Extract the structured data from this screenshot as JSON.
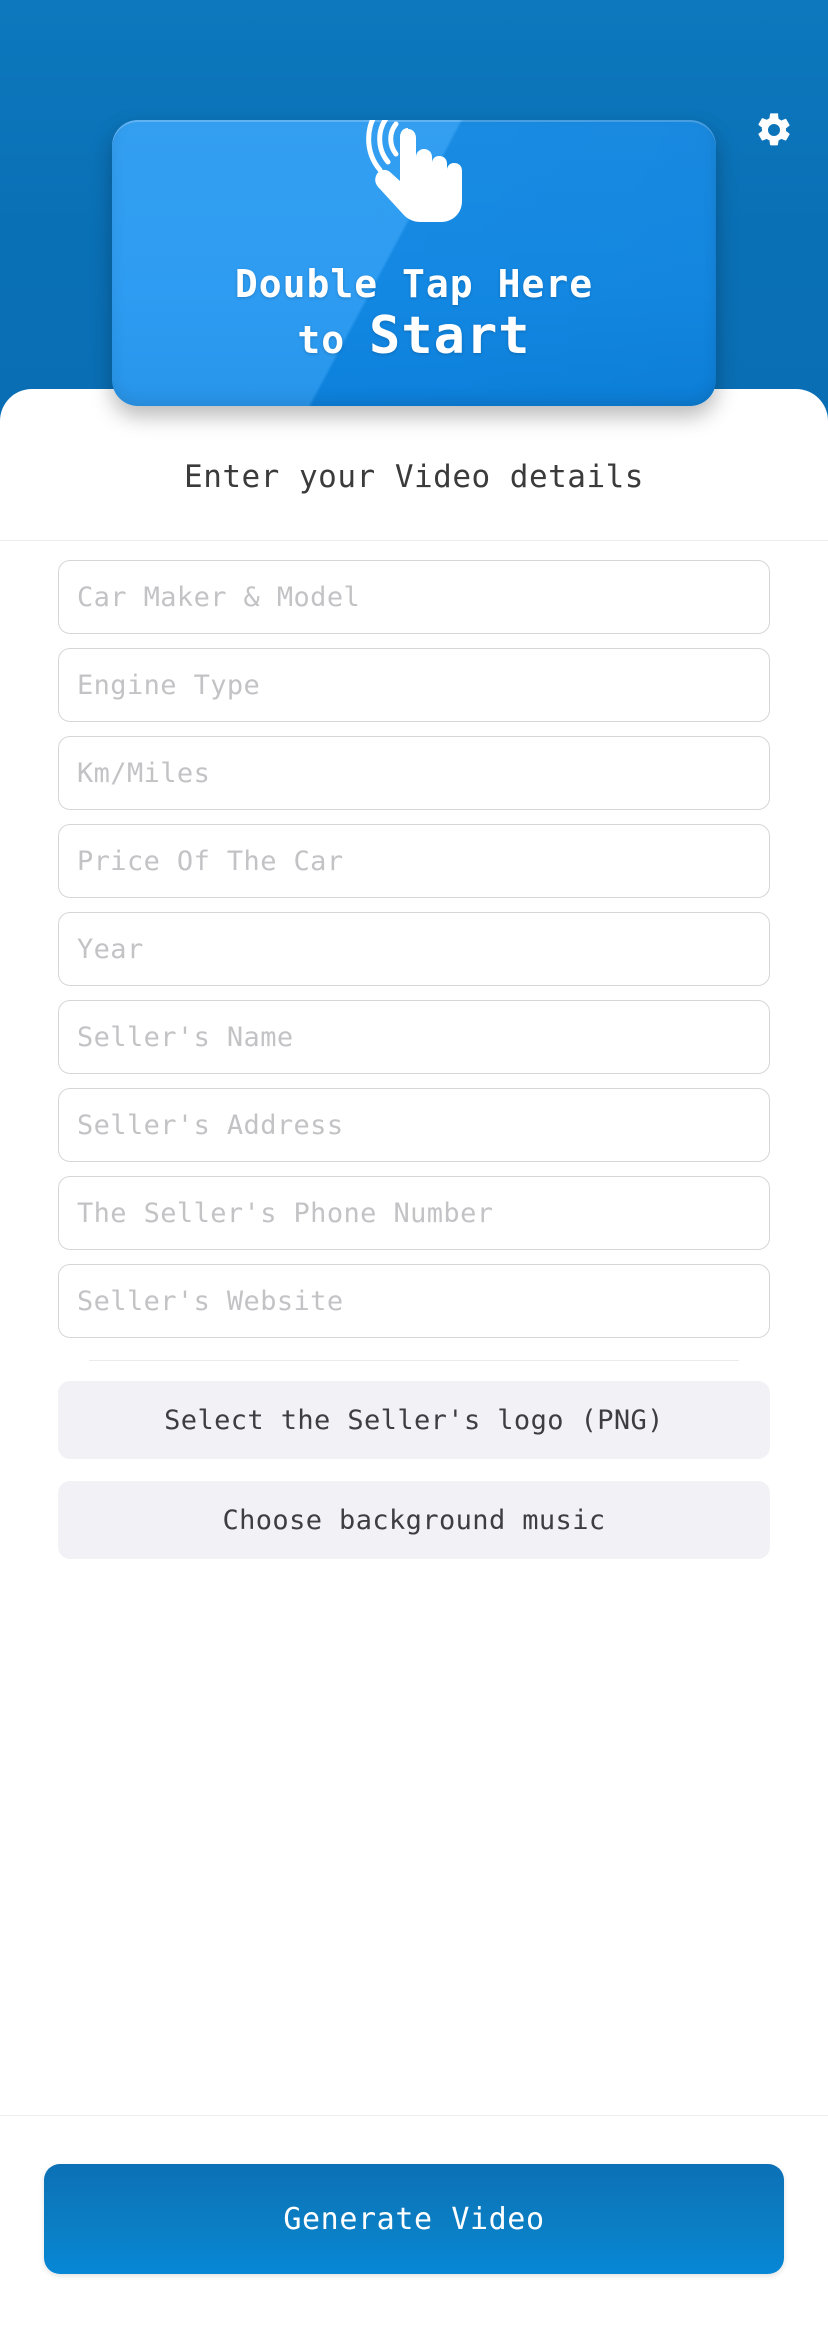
{
  "hero": {
    "settings_icon": "gear-icon",
    "tap_card": {
      "icon": "double-tap-hand-icon",
      "line1": "Double Tap Here",
      "line2_small": "to ",
      "line2_large": "Start"
    },
    "background_color": "#0B72B8",
    "card_color": "#1490F0"
  },
  "sheet": {
    "title": "Enter your Video details",
    "fields": [
      {
        "name": "car-maker-model",
        "placeholder": "Car Maker & Model",
        "value": ""
      },
      {
        "name": "engine-type",
        "placeholder": "Engine Type",
        "value": ""
      },
      {
        "name": "km-miles",
        "placeholder": "Km/Miles",
        "value": ""
      },
      {
        "name": "price-of-the-car",
        "placeholder": "Price Of The Car",
        "value": ""
      },
      {
        "name": "year",
        "placeholder": "Year",
        "value": ""
      },
      {
        "name": "sellers-name",
        "placeholder": "Seller's Name",
        "value": ""
      },
      {
        "name": "sellers-address",
        "placeholder": "Seller's Address",
        "value": ""
      },
      {
        "name": "sellers-phone-number",
        "placeholder": "The Seller's Phone Number",
        "value": ""
      },
      {
        "name": "sellers-website",
        "placeholder": "Seller's Website",
        "value": ""
      }
    ],
    "pickers": [
      {
        "name": "select-seller-logo",
        "label": "Select the Seller's logo (PNG)"
      },
      {
        "name": "choose-background-music",
        "label": "Choose background music"
      }
    ]
  },
  "footer": {
    "generate_label": "Generate Video",
    "generate_color": "#0B7EC3"
  }
}
